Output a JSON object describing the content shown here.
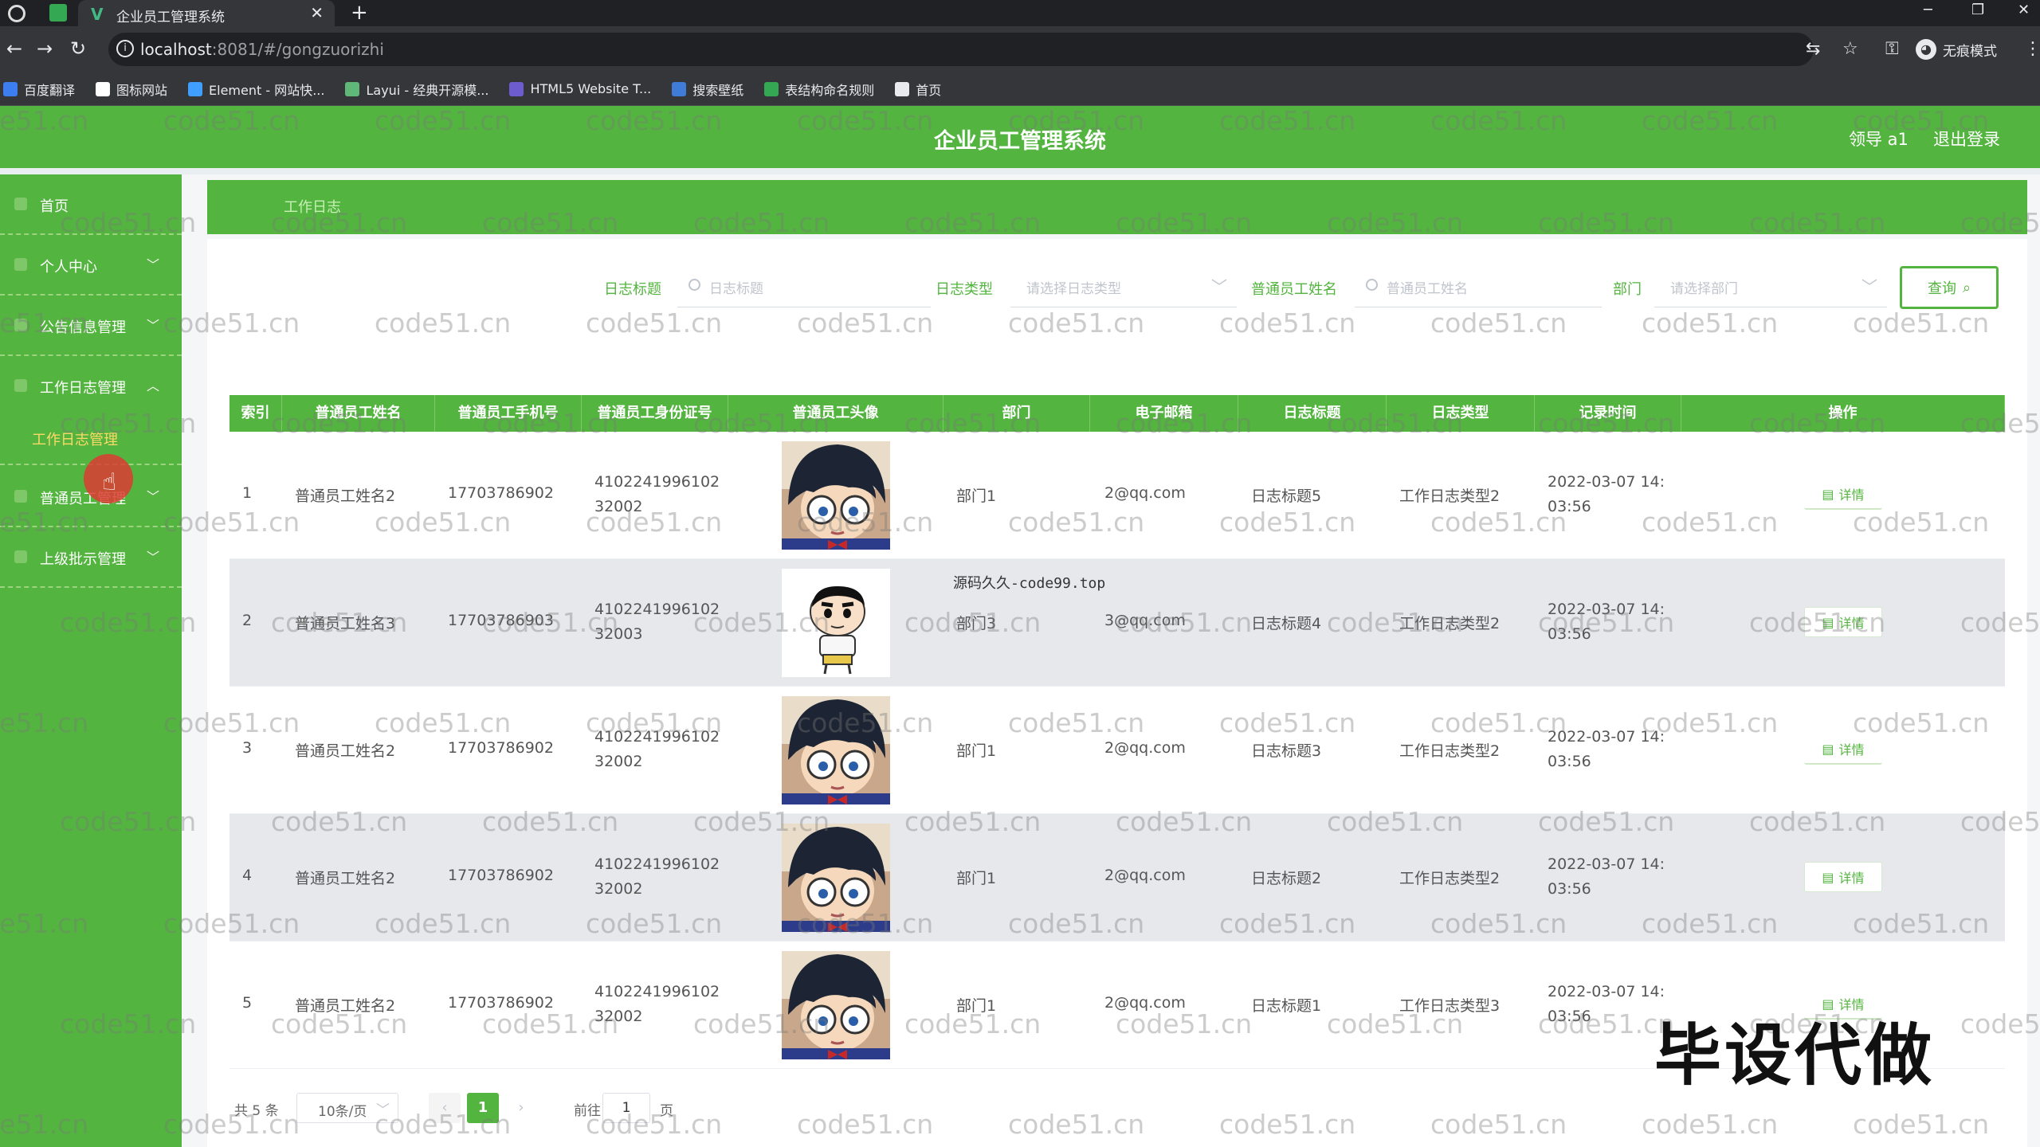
{
  "browser": {
    "tab_title": "企业员工管理系统",
    "url_host": "localhost",
    "url_rest": ":8081/#/gongzuorizhi",
    "incognito_label": "无痕模式",
    "bookmarks": [
      {
        "label": "百度翻译",
        "color": "#3c7ef0"
      },
      {
        "label": "图标网站",
        "color": "#ffffff"
      },
      {
        "label": "Element - 网站快...",
        "color": "#409eff"
      },
      {
        "label": "Layui - 经典开源模...",
        "color": "#5fb878"
      },
      {
        "label": "HTML5 Website T...",
        "color": "#6d5bd0"
      },
      {
        "label": "搜索壁纸",
        "color": "#3f7cd8"
      },
      {
        "label": "表结构命名规则",
        "color": "#34a853"
      },
      {
        "label": "首页",
        "color": "#e8eaed"
      }
    ]
  },
  "header": {
    "title": "企业员工管理系统",
    "user": "领导 a1",
    "logout": "退出登录"
  },
  "sidebar": {
    "items": [
      {
        "label": "首页",
        "expandable": false
      },
      {
        "label": "个人中心",
        "expandable": true
      },
      {
        "label": "公告信息管理",
        "expandable": true
      },
      {
        "label": "工作日志管理",
        "expandable": true,
        "expanded": true
      },
      {
        "label": "普通员工管理",
        "expandable": true
      },
      {
        "label": "上级批示管理",
        "expandable": true
      }
    ],
    "sub_item": "工作日志管理"
  },
  "banner": {
    "text": "工作日志"
  },
  "filters": {
    "title_label": "日志标题",
    "title_placeholder": "日志标题",
    "type_label": "日志类型",
    "type_placeholder": "请选择日志类型",
    "name_label": "普通员工姓名",
    "name_placeholder": "普通员工姓名",
    "dept_label": "部门",
    "dept_placeholder": "请选择部门",
    "query_button": "查询"
  },
  "table": {
    "columns": [
      "索引",
      "普通员工姓名",
      "普通员工手机号",
      "普通员工身份证号",
      "普通员工头像",
      "部门",
      "电子邮箱",
      "日志标题",
      "日志类型",
      "记录时间",
      "操作"
    ],
    "detail_label": "详情",
    "rows": [
      {
        "index": "1",
        "name": "普通员工姓名2",
        "phone": "17703786902",
        "id_card": "410224199610232002",
        "avatar": "conan",
        "dept": "部门1",
        "email": "2@qq.com",
        "title": "日志标题5",
        "type": "工作日志类型2",
        "time": "2022-03-07 14:03:56"
      },
      {
        "index": "2",
        "name": "普通员工姓名3",
        "phone": "17703786903",
        "id_card": "410224199610232003",
        "avatar": "shinchan",
        "dept": "部门3",
        "email": "3@qq.com",
        "title": "日志标题4",
        "type": "工作日志类型2",
        "time": "2022-03-07 14:03:56"
      },
      {
        "index": "3",
        "name": "普通员工姓名2",
        "phone": "17703786902",
        "id_card": "410224199610232002",
        "avatar": "conan",
        "dept": "部门1",
        "email": "2@qq.com",
        "title": "日志标题3",
        "type": "工作日志类型2",
        "time": "2022-03-07 14:03:56"
      },
      {
        "index": "4",
        "name": "普通员工姓名2",
        "phone": "17703786902",
        "id_card": "410224199610232002",
        "avatar": "conan",
        "dept": "部门1",
        "email": "2@qq.com",
        "title": "日志标题2",
        "type": "工作日志类型2",
        "time": "2022-03-07 14:03:56"
      },
      {
        "index": "5",
        "name": "普通员工姓名2",
        "phone": "17703786902",
        "id_card": "410224199610232002",
        "avatar": "conan",
        "dept": "部门1",
        "email": "2@qq.com",
        "title": "日志标题1",
        "type": "工作日志类型3",
        "time": "2022-03-07 14:03:56"
      }
    ]
  },
  "pagination": {
    "total": "共 5 条",
    "page_size": "10条/页",
    "current_page": "1",
    "goto_prefix": "前往",
    "goto_value": "1",
    "goto_suffix": "页"
  },
  "overlays": {
    "watermark": "code51.cn",
    "tag": "源码久久-code99.top",
    "banner": "毕设代做"
  },
  "colors": {
    "accent": "#53b43f"
  }
}
